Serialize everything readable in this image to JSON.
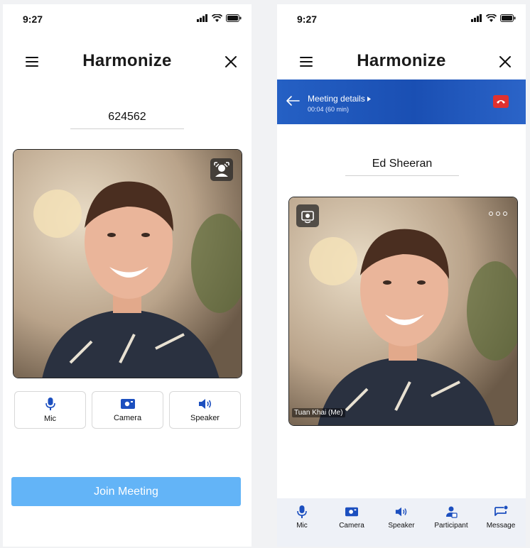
{
  "left": {
    "status": {
      "time": "9:27"
    },
    "header": {
      "title": "Harmonize"
    },
    "meeting_code": "624562",
    "controls": [
      {
        "label": "Mic",
        "icon": "mic-icon"
      },
      {
        "label": "Camera",
        "icon": "camera-icon"
      },
      {
        "label": "Speaker",
        "icon": "speaker-icon"
      }
    ],
    "join_button": "Join Meeting"
  },
  "right": {
    "status": {
      "time": "9:27"
    },
    "header": {
      "title": "Harmonize"
    },
    "banner": {
      "title": "Meeting details",
      "subtitle": "00:04 (60 min)"
    },
    "participant_name": "Ed Sheeran",
    "self_label": "Tuan Khai (Me)",
    "nav": [
      {
        "label": "Mic",
        "icon": "mic-icon"
      },
      {
        "label": "Camera",
        "icon": "camera-icon"
      },
      {
        "label": "Speaker",
        "icon": "speaker-icon"
      },
      {
        "label": "Participant",
        "icon": "participant-icon"
      },
      {
        "label": "Message",
        "icon": "message-icon"
      }
    ]
  },
  "colors": {
    "accent": "#1c4fbf",
    "join_button": "#63b4f7",
    "end_call": "#e0312f"
  }
}
